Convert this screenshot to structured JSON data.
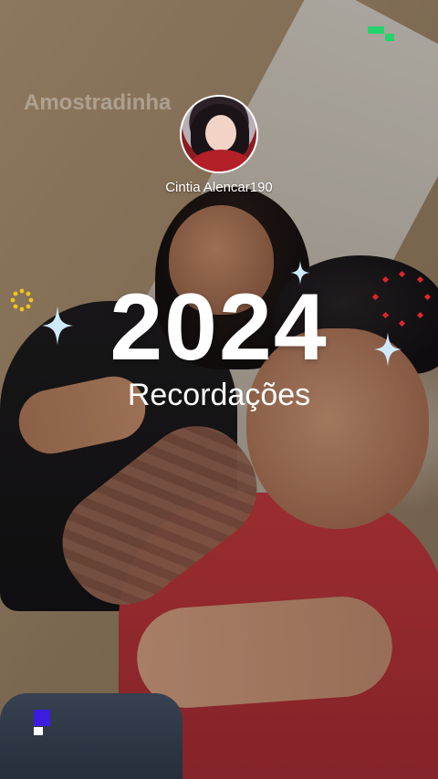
{
  "story": {
    "watermark": "Amostradinha",
    "username": "Cintia Alencar190",
    "year": "2024",
    "subtitle": "Recordações"
  },
  "colors": {
    "accent_gold": "#f2c418",
    "accent_red": "#e0262b",
    "sparkle": "#cfe9ff",
    "logo_green": "#22d46a",
    "indicator_blue": "#3b1de0"
  },
  "icons": {
    "profile": "avatar-image",
    "decorations": [
      "sparkle-icon",
      "sparkle-icon",
      "sparkle-icon",
      "sun-icon",
      "dotted-ring-icon"
    ],
    "app_logo": "pixel-logo-icon"
  }
}
